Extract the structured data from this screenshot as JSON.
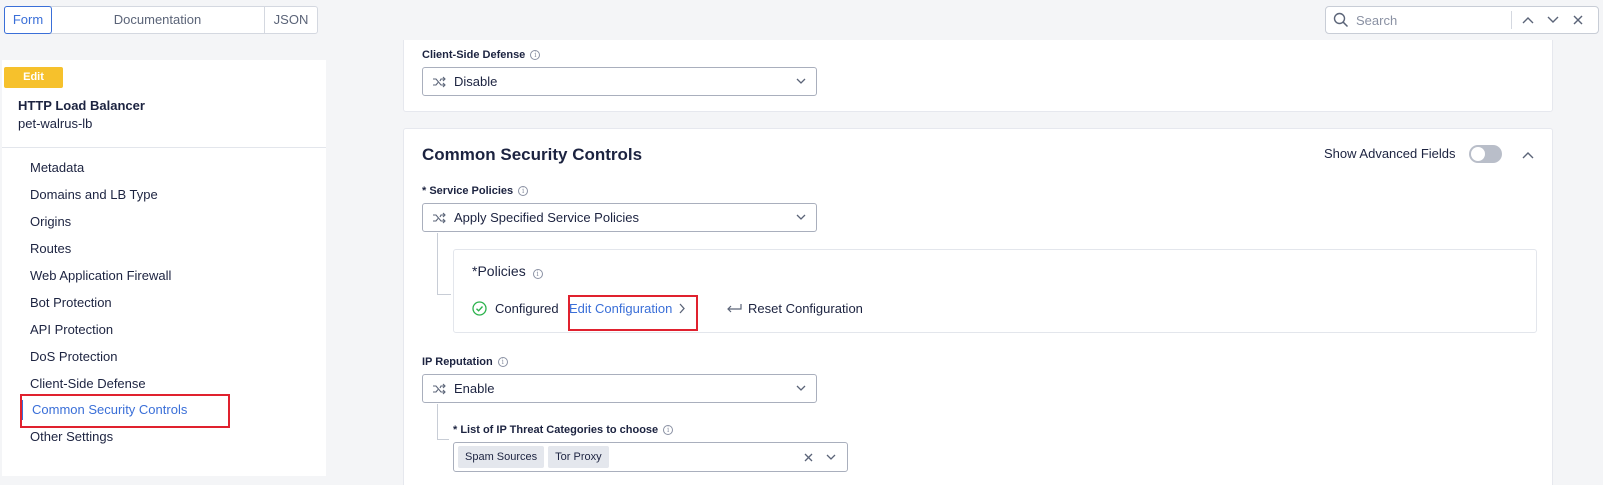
{
  "tabs": [
    {
      "label": "Form",
      "active": true
    },
    {
      "label": "Documentation",
      "active": false
    },
    {
      "label": "JSON",
      "active": false
    }
  ],
  "search": {
    "placeholder": "Search"
  },
  "sidebar": {
    "badge": "Edit",
    "object_type": "HTTP Load Balancer",
    "object_name": "pet-walrus-lb",
    "items": [
      {
        "label": "Metadata"
      },
      {
        "label": "Domains and LB Type"
      },
      {
        "label": "Origins"
      },
      {
        "label": "Routes"
      },
      {
        "label": "Web Application Firewall"
      },
      {
        "label": "Bot Protection"
      },
      {
        "label": "API Protection"
      },
      {
        "label": "DoS Protection"
      },
      {
        "label": "Client-Side Defense"
      },
      {
        "label": "Common Security Controls",
        "active": true
      },
      {
        "label": "Other Settings"
      }
    ]
  },
  "client_side_defense": {
    "label": "Client-Side Defense",
    "value": "Disable"
  },
  "common_security": {
    "title": "Common Security Controls",
    "show_advanced_label": "Show Advanced Fields",
    "show_advanced_on": false,
    "service_policies": {
      "label": "* Service Policies",
      "value": "Apply Specified Service Policies"
    },
    "policies": {
      "title": "Policies",
      "required_mark": "*",
      "status": "Configured",
      "edit_label": "Edit Configuration",
      "reset_label": "Reset Configuration"
    },
    "ip_reputation": {
      "label": "IP Reputation",
      "value": "Enable"
    },
    "ip_threat_categories": {
      "label": "* List of IP Threat Categories to choose",
      "chips": [
        "Spam Sources",
        "Tor Proxy"
      ]
    }
  },
  "colors": {
    "accent": "#3a6fd8",
    "badge": "#f6c12c",
    "highlight": "#e0212e",
    "success": "#2bb24c"
  }
}
